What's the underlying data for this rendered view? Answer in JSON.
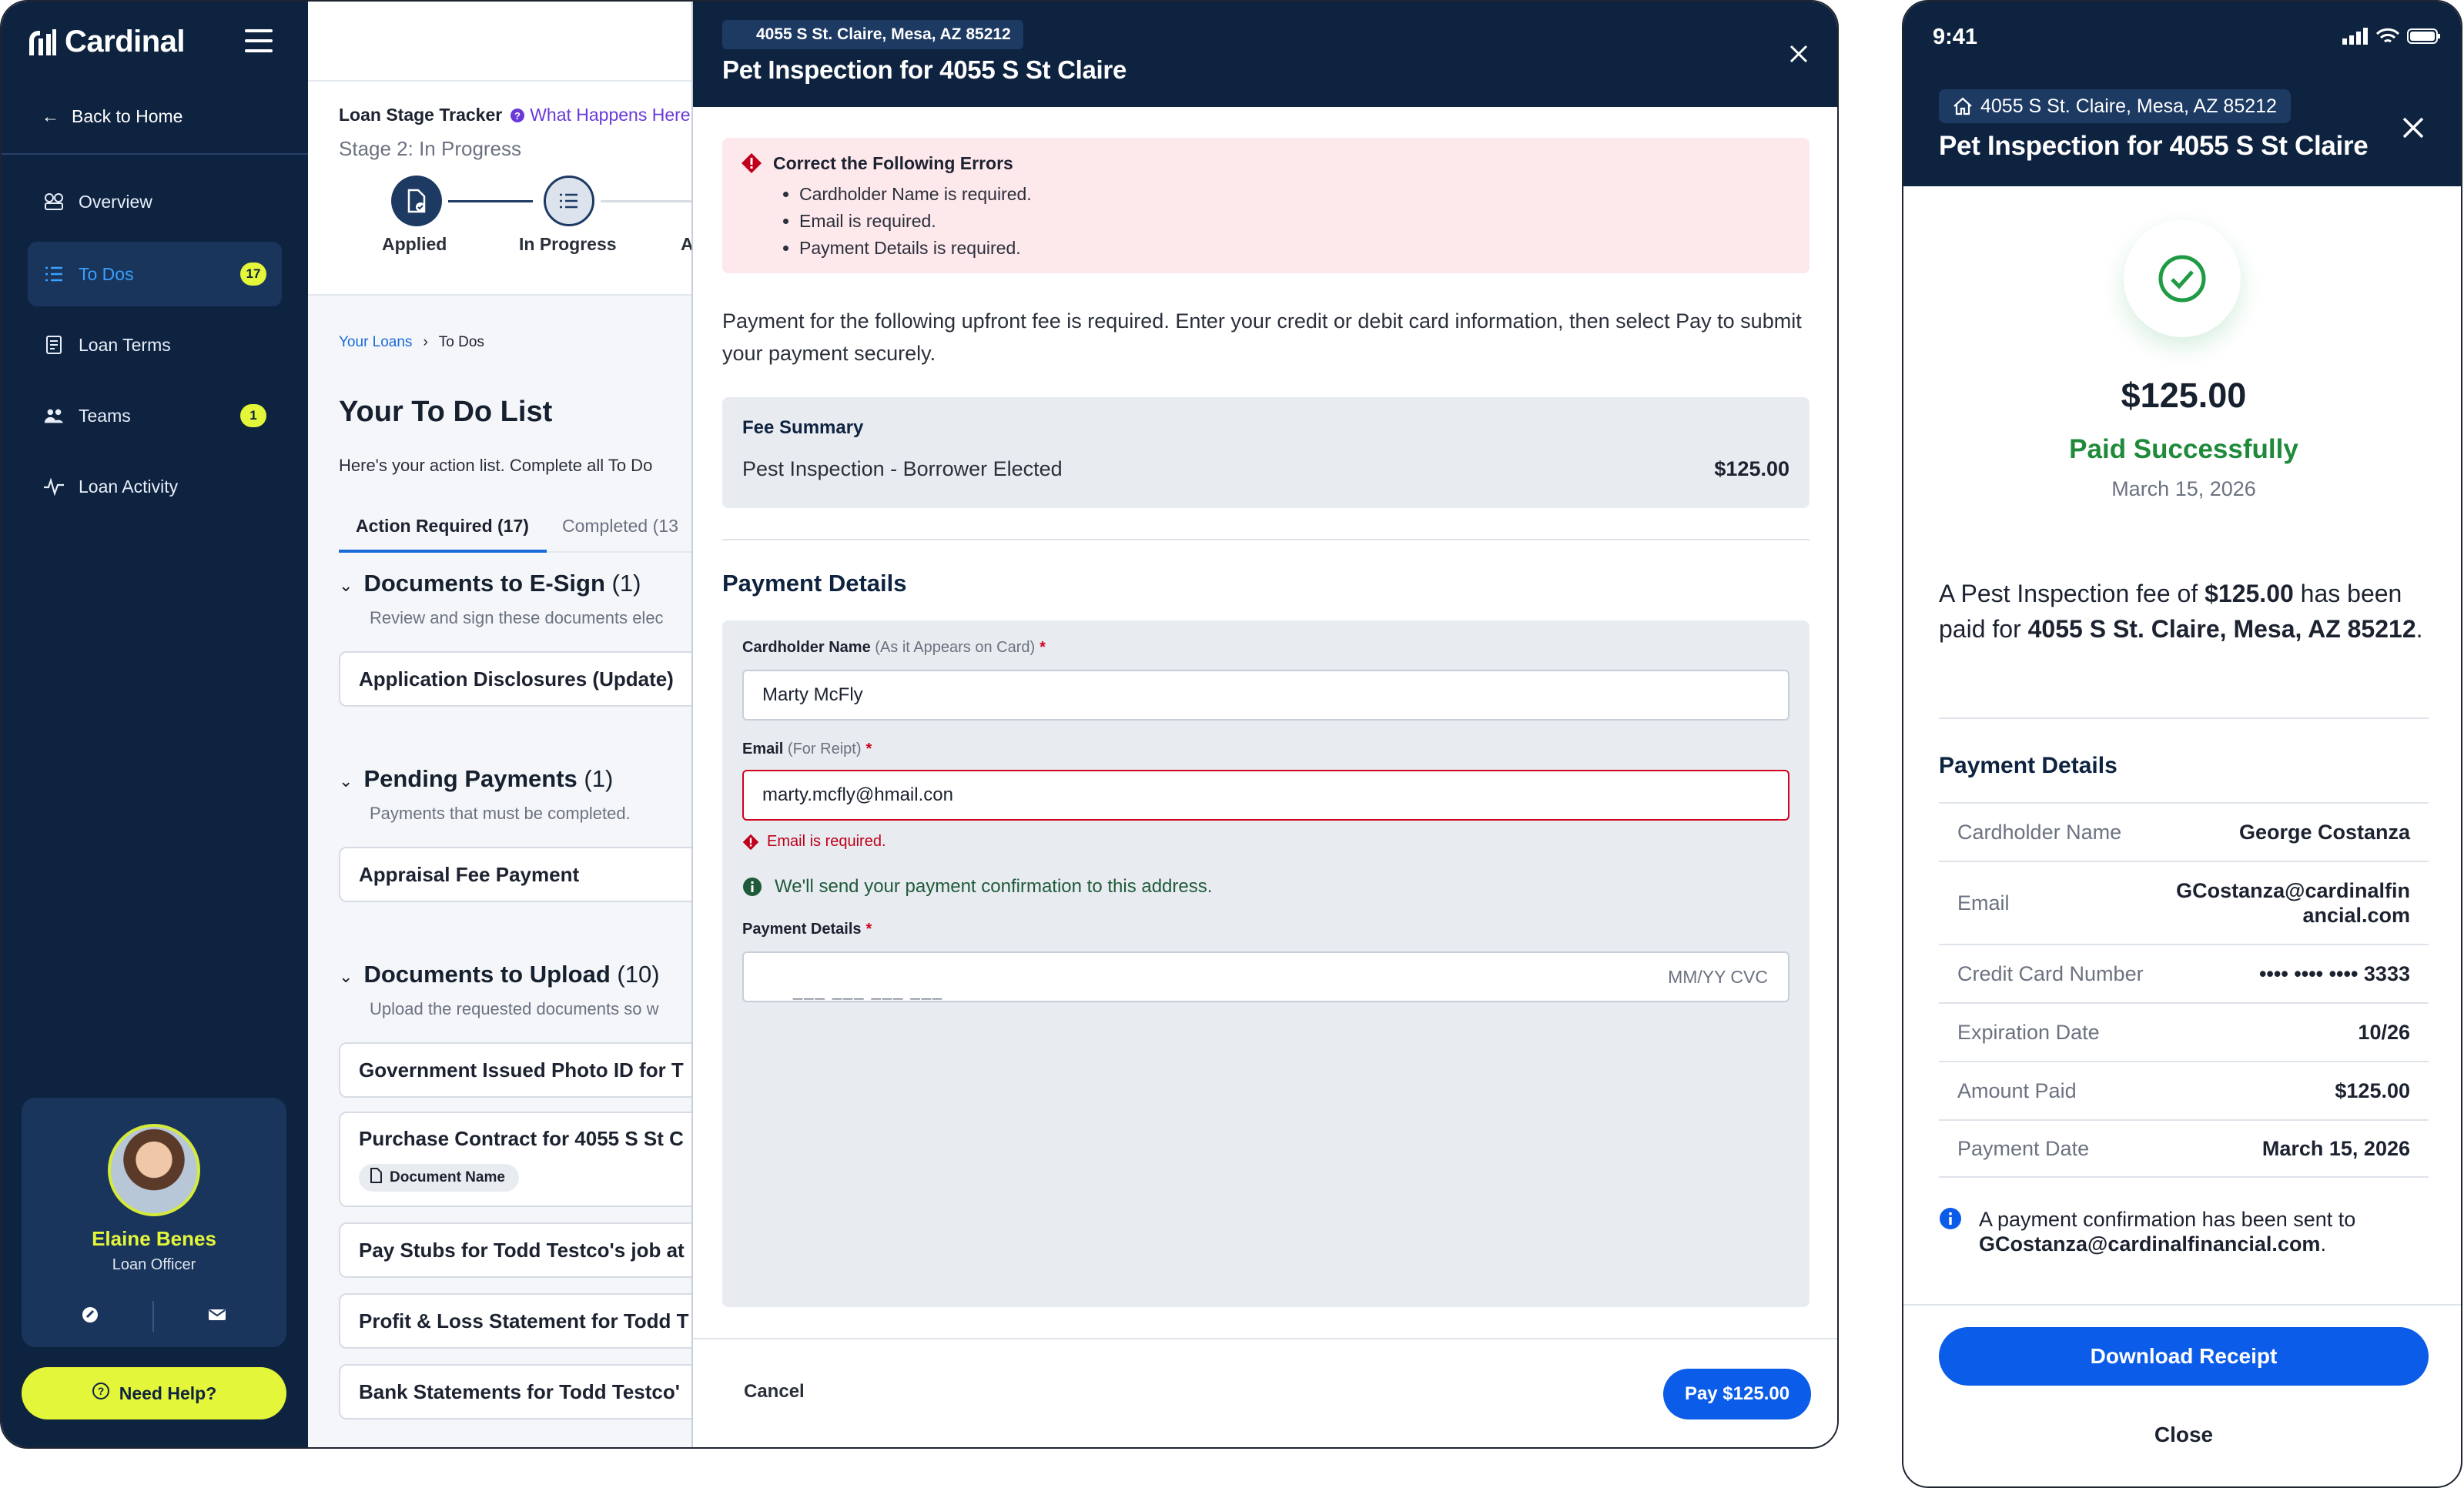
{
  "brand": {
    "name": "Cardinal",
    "accent": "#e4f63a",
    "navy": "#0e2340",
    "primary": "#0b5ce8"
  },
  "sidebar": {
    "back_label": "Back to Home",
    "items": [
      {
        "label": "Overview",
        "icon": "overview-icon"
      },
      {
        "label": "To Dos",
        "icon": "todo-list-icon",
        "badge": "17",
        "active": true
      },
      {
        "label": "Loan Terms",
        "icon": "document-icon"
      },
      {
        "label": "Teams",
        "icon": "people-icon",
        "badge": "1"
      },
      {
        "label": "Loan Activity",
        "icon": "activity-icon"
      }
    ],
    "officer": {
      "name": "Elaine Benes",
      "role": "Loan Officer"
    },
    "help_label": "Need Help?"
  },
  "tracker": {
    "title": "Loan Stage Tracker",
    "help_link": "What Happens Here",
    "stage": "Stage 2: In Progress",
    "steps": [
      "Applied",
      "In Progress",
      "A"
    ]
  },
  "breadcrumb": {
    "root": "Your Loans",
    "current": "To Dos"
  },
  "todo": {
    "title": "Your To Do List",
    "subtitle": "Here's your action list. Complete all To Do",
    "tabs": [
      "Action Required (17)",
      "Completed (13"
    ],
    "sections": [
      {
        "title": "Documents to E-Sign",
        "count": "(1)",
        "desc": "Review and sign these documents elec",
        "items": [
          "Application Disclosures (Update)"
        ]
      },
      {
        "title": "Pending Payments",
        "count": "(1)",
        "desc": "Payments that must be completed.",
        "items": [
          "Appraisal Fee Payment"
        ]
      },
      {
        "title": "Documents to Upload",
        "count": "(10)",
        "desc": "Upload the requested documents so w",
        "items": [
          "Government Issued Photo ID for T",
          "Purchase Contract for 4055 S St C",
          "Pay Stubs for Todd Testco's job at",
          "Profit & Loss Statement for Todd T",
          "Bank Statements for Todd Testco'"
        ]
      }
    ],
    "chip_label": "Document Name"
  },
  "modal": {
    "address": "4055 S St. Claire, Mesa, AZ 85212",
    "title": "Pet Inspection for 4055 S St Claire",
    "errors": {
      "heading": "Correct the Following Errors",
      "items": [
        "Cardholder Name is required.",
        "Email is required.",
        "Payment Details is required."
      ]
    },
    "intro": "Payment for the following upfront fee is required. Enter your credit or debit card information, then select Pay to submit your payment securely.",
    "fee": {
      "label": "Fee Summary",
      "item": "Pest Inspection - Borrower Elected",
      "amount": "$125.00"
    },
    "payment_heading": "Payment Details",
    "fields": {
      "name_label": "Cardholder Name",
      "name_hint": "(As it Appears on Card)",
      "name_value": "Marty McFly",
      "email_label": "Email",
      "email_hint": "(For Reipt)",
      "email_value": "marty.mcfly@hmail.con",
      "email_error": "Email is required.",
      "email_info": "We'll send your payment confirmation to this address.",
      "card_label": "Payment Details",
      "card_placeholder": "___ ___ ___ ___",
      "card_meta": "MM/YY  CVC",
      "required_mark": "*"
    },
    "cancel_label": "Cancel",
    "pay_label": "Pay $125.00"
  },
  "phone": {
    "time": "9:41",
    "address": "4055 S St. Claire, Mesa, AZ 85212",
    "title": "Pet Inspection for 4055 S St Claire",
    "amount": "$125.00",
    "status": "Paid Successfully",
    "date": "March 15, 2026",
    "message": {
      "pre": "A Pest Inspection fee of ",
      "amount": "$125.00",
      "mid": " has been paid for ",
      "address": "4055 S St. Claire, Mesa, AZ 85212",
      "post": "."
    },
    "details_heading": "Payment Details",
    "details": [
      {
        "k": "Cardholder Name",
        "v": "George Costanza"
      },
      {
        "k": "Email",
        "v": "GCostanza@cardinalfinancial.com"
      },
      {
        "k": "Credit Card Number",
        "v": "•••• •••• •••• 3333"
      },
      {
        "k": "Expiration Date",
        "v": "10/26"
      },
      {
        "k": "Amount Paid",
        "v": "$125.00"
      },
      {
        "k": "Payment Date",
        "v": "March 15, 2026"
      }
    ],
    "note_pre": "A payment confirmation has been sent to ",
    "note_email": "GCostanza@cardinalfinancial.com",
    "note_post": ".",
    "download_label": "Download Receipt",
    "close_label": "Close"
  }
}
